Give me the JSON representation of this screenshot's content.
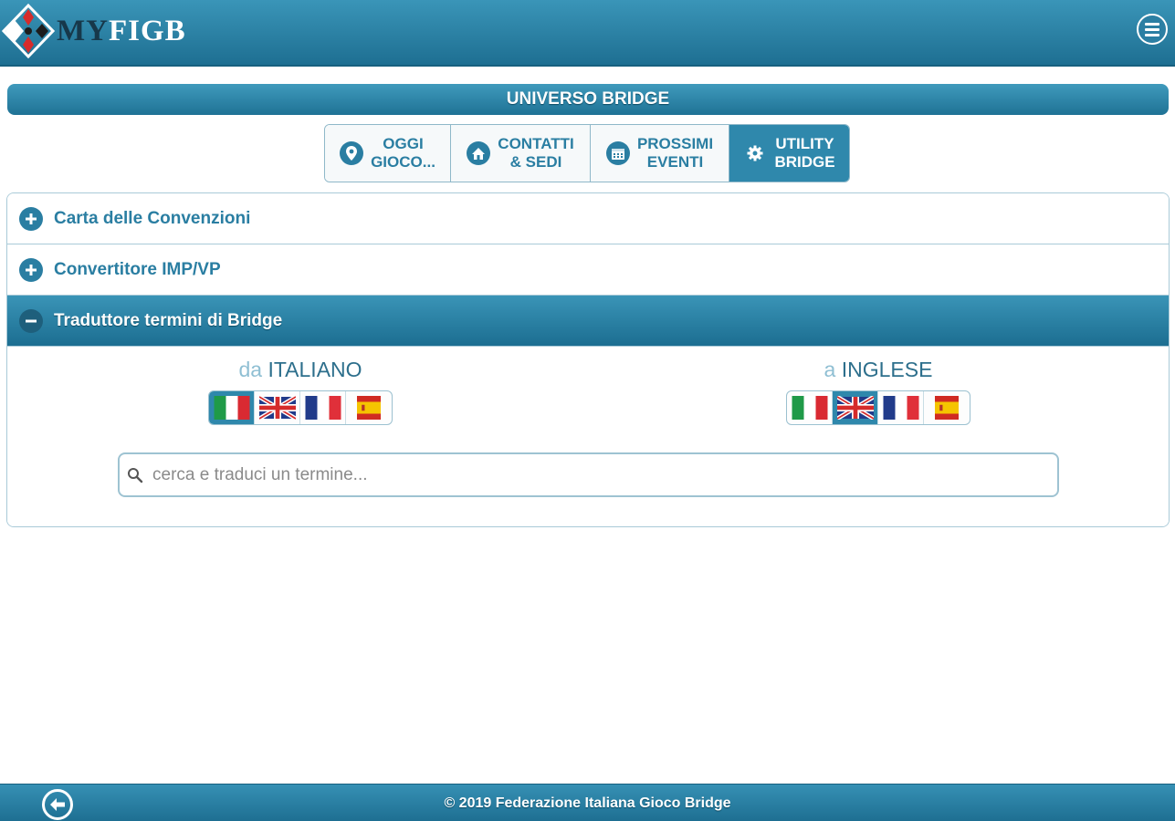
{
  "header": {
    "logo_my": "MY",
    "logo_figb": "FIGB",
    "menu_icon": "hamburger-menu-icon"
  },
  "section": {
    "title": "UNIVERSO BRIDGE"
  },
  "tabs": [
    {
      "line1": "OGGI",
      "line2": "GIOCO...",
      "icon": "map-pin-icon",
      "active": false
    },
    {
      "line1": "CONTATTI",
      "line2": "& SEDI",
      "icon": "home-icon",
      "active": false
    },
    {
      "line1": "PROSSIMI",
      "line2": "EVENTI",
      "icon": "calendar-icon",
      "active": false
    },
    {
      "line1": "UTILITY",
      "line2": "BRIDGE",
      "icon": "gear-icon",
      "active": true
    }
  ],
  "accordion": {
    "items": [
      {
        "label": "Carta delle Convenzioni",
        "expanded": false
      },
      {
        "label": "Convertitore IMP/VP",
        "expanded": false
      },
      {
        "label": "Traduttore termini di Bridge",
        "expanded": true
      }
    ]
  },
  "translator": {
    "from": {
      "prefix": "da",
      "language": "ITALIANO",
      "selected": "it"
    },
    "to": {
      "prefix": "a",
      "language": "INGLESE",
      "selected": "en"
    },
    "flags": [
      "it",
      "en",
      "fr",
      "es"
    ],
    "search_placeholder": "cerca e traduci un termine...",
    "search_value": ""
  },
  "footer": {
    "copyright": "© 2019 Federazione Italiana Gioco Bridge",
    "back_icon": "back-arrow-icon"
  },
  "colors": {
    "brand": "#2a7ea2",
    "header_top": "#3a95b8",
    "header_bottom": "#1e6f92",
    "active_tab": "#2f88ac"
  }
}
